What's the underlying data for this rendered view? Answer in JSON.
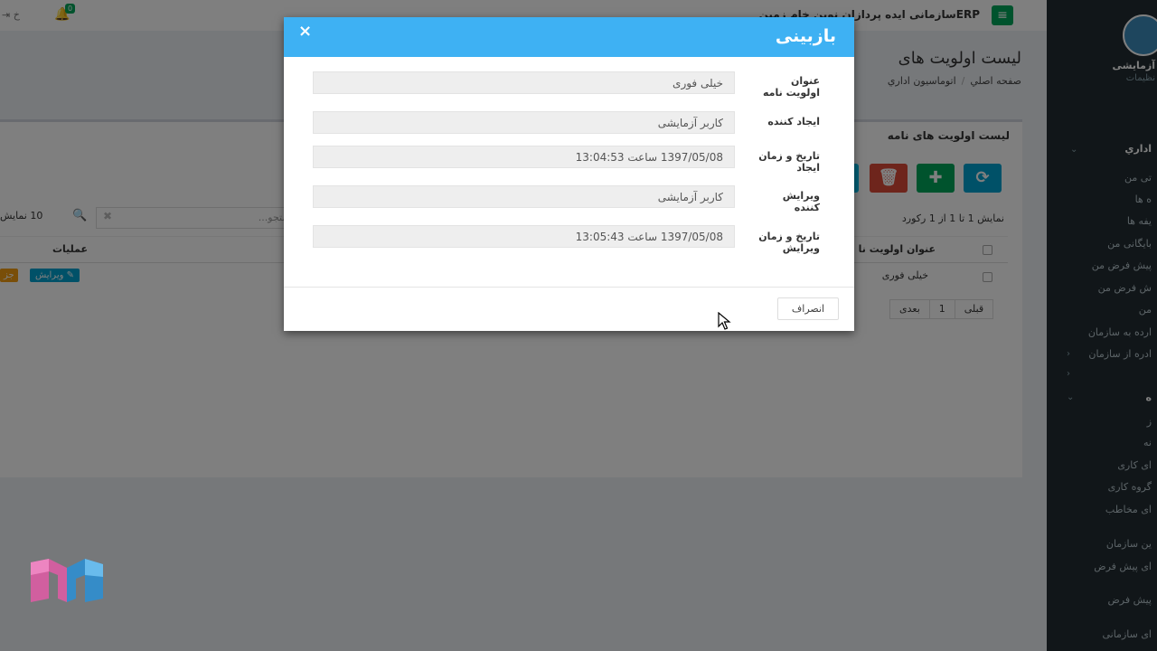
{
  "topbar": {
    "app_title": "ERPسازمانی ایده پردازان نوین خام زمین",
    "notification_count": "0",
    "logout_label": "خ"
  },
  "page": {
    "title": "لیست اولویت های",
    "breadcrumb": [
      "صفحه اصلي",
      "اتوماسيون اداري"
    ]
  },
  "box": {
    "title": "لیست اولویت های نامه",
    "records_info": "نمایش 1 تا 1 از 1 رکورد",
    "show_label": "نمایش",
    "page_size": "10",
    "search_placeholder": "جستجو...",
    "columns": {
      "operations": "عملیات",
      "title": "عنوان اولویت نا"
    },
    "rows": [
      {
        "title": "خیلی فوری",
        "edit_label": "ویرایش",
        "detail_label": "جز"
      }
    ],
    "pager": {
      "prev": "قبلی",
      "page": "1",
      "next": "بعدی"
    }
  },
  "sidebar": {
    "user_name": "آزمایشی",
    "user_sub": "نظیمات",
    "items": [
      "اداري",
      "تی من",
      "ه ها",
      "یفه ها",
      "بایگانی من",
      "پیش فرض من",
      "ش فرض من",
      "من",
      "ارده به سازمان",
      "ادره از سازمان",
      "ه",
      "ز",
      "نه",
      "ای کاری",
      "گروه کاری",
      "ای مخاطب",
      "ین سازمان",
      "ای پیش فرض",
      "پیش فرض",
      "ای سازمانی"
    ]
  },
  "modal": {
    "title": "بازبینی",
    "close_icon": "×",
    "fields": [
      {
        "label": "عنوان اولویت نامه",
        "value": "خیلی فوری"
      },
      {
        "label": "ایجاد کننده",
        "value": "کاربر آزمایشی"
      },
      {
        "label": "تاریخ و زمان ایجاد",
        "value": "1397/05/08 ساعت 13:04:53"
      },
      {
        "label": "ویرایش کننده",
        "value": "کاربر آزمایشی"
      },
      {
        "label": "تاریخ و زمان ویرایش",
        "value": "1397/05/08 ساعت 13:05:43"
      }
    ],
    "cancel_label": "انصراف"
  },
  "colors": {
    "modal_header": "#3eb1f3",
    "success": "#00a65a",
    "danger": "#dd4b39",
    "info": "#00a2d0",
    "warning": "#f39c12",
    "sidebar": "#222d32"
  }
}
